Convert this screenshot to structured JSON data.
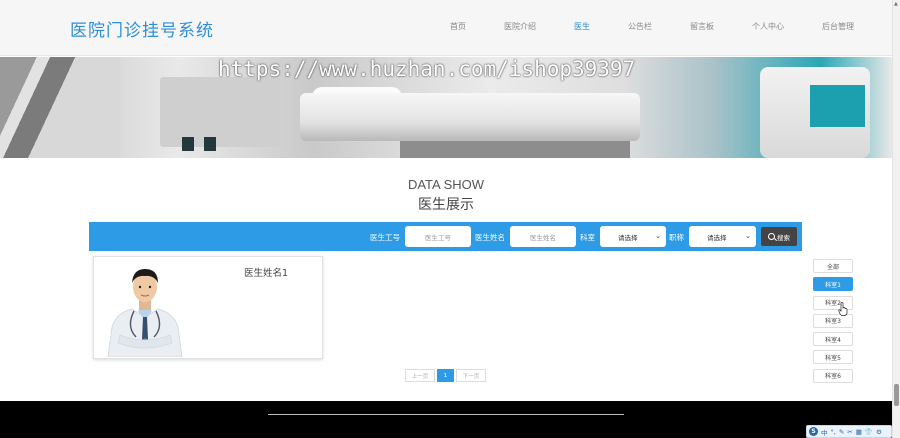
{
  "header": {
    "site_title": "医院门诊挂号系统",
    "nav": [
      {
        "label": "首页",
        "active": false
      },
      {
        "label": "医院介绍",
        "active": false
      },
      {
        "label": "医生",
        "active": true
      },
      {
        "label": "公告栏",
        "active": false
      },
      {
        "label": "留言板",
        "active": false
      },
      {
        "label": "个人中心",
        "active": false
      },
      {
        "label": "后台管理",
        "active": false
      }
    ]
  },
  "banner": {
    "watermark": "https://www.huzhan.com/ishop39397"
  },
  "section": {
    "title_en": "DATA SHOW",
    "title_cn": "医生展示"
  },
  "search": {
    "doctor_id_label": "医生工号",
    "doctor_id_placeholder": "医生工号",
    "doctor_name_label": "医生姓名",
    "doctor_name_placeholder": "医生姓名",
    "department_label": "科室",
    "department_value": "请选择",
    "title_label": "职称",
    "title_value": "请选择",
    "search_button": "搜索"
  },
  "doctors": [
    {
      "name": "医生姓名1"
    }
  ],
  "pagination": {
    "prev": "上一页",
    "current": "1",
    "next": "下一页"
  },
  "categories": [
    {
      "label": "全部",
      "active": false
    },
    {
      "label": "科室1",
      "active": true
    },
    {
      "label": "科室2",
      "active": false
    },
    {
      "label": "科室3",
      "active": false
    },
    {
      "label": "科室4",
      "active": false
    },
    {
      "label": "科室5",
      "active": false
    },
    {
      "label": "科室6",
      "active": false
    }
  ],
  "ime": {
    "logo": "S",
    "mode": "中"
  },
  "colors": {
    "accent": "#2e9be6",
    "title": "#2e8fd9",
    "footer": "#000000"
  }
}
